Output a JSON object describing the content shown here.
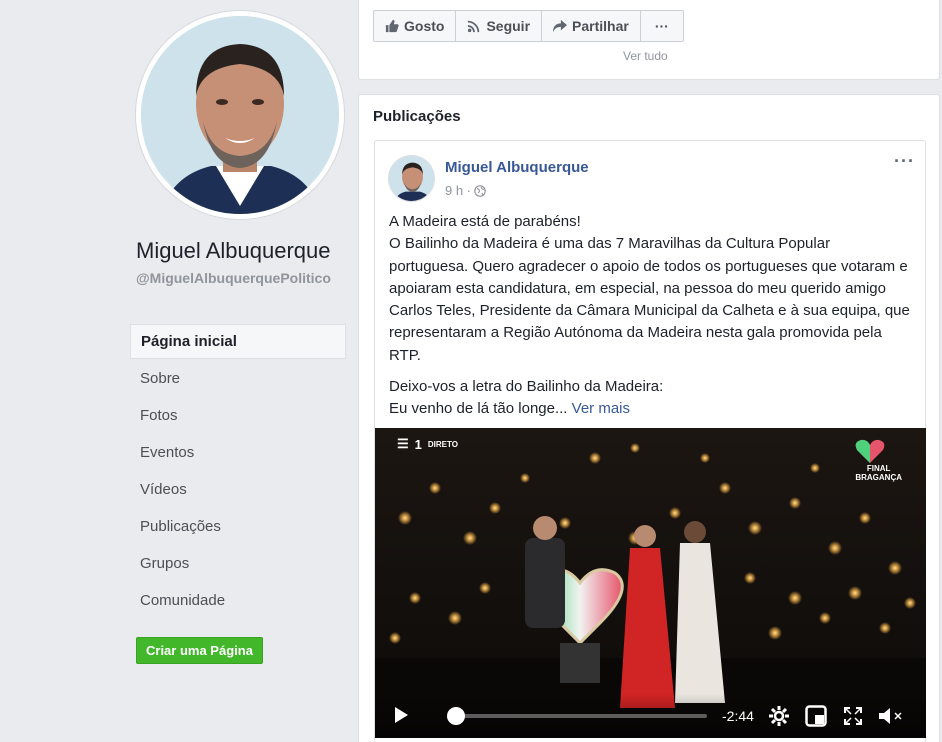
{
  "profile": {
    "name": "Miguel Albuquerque",
    "handle": "@MiguelAlbuquerquePolitico"
  },
  "nav": {
    "items": [
      {
        "label": "Página inicial",
        "active": true
      },
      {
        "label": "Sobre"
      },
      {
        "label": "Fotos"
      },
      {
        "label": "Eventos"
      },
      {
        "label": "Vídeos"
      },
      {
        "label": "Publicações"
      },
      {
        "label": "Grupos"
      },
      {
        "label": "Comunidade"
      }
    ],
    "create_page": "Criar uma Página"
  },
  "actions": {
    "like": "Gosto",
    "follow": "Seguir",
    "share": "Partilhar",
    "more": "···",
    "see_all_cut": "Ver tudo"
  },
  "posts_section": {
    "title": "Publicações"
  },
  "post": {
    "author": "Miguel Albuquerque",
    "time": "9 h ·",
    "more": "···",
    "text_para1": [
      "A Madeira está de parabéns!",
      "O Bailinho da Madeira é uma das 7 Maravilhas da Cultura Popular portuguesa. Quero agradecer o apoio de todos os portugueses que votaram e apoiaram esta candidatura, em especial, na pessoa do meu querido amigo Carlos Teles, Presidente da Câmara Municipal da Calheta e à sua equipa, que representaram a Região Autónoma da Madeira nesta gala promovida pela RTP."
    ],
    "text_para2": [
      "Deixo-vos a letra do Bailinho da Madeira:",
      "Eu venho de lá tão longe..."
    ],
    "see_more": "Ver mais"
  },
  "video": {
    "channel": "1",
    "live_label": "DIRETO",
    "corner_logo_line1": "FINAL",
    "corner_logo_line2": "BRAGANÇA",
    "time_remaining": "-2:44",
    "progress": 0.02
  },
  "colors": {
    "link": "#385898",
    "create_button": "#42b72a",
    "background": "#e9ebee"
  }
}
